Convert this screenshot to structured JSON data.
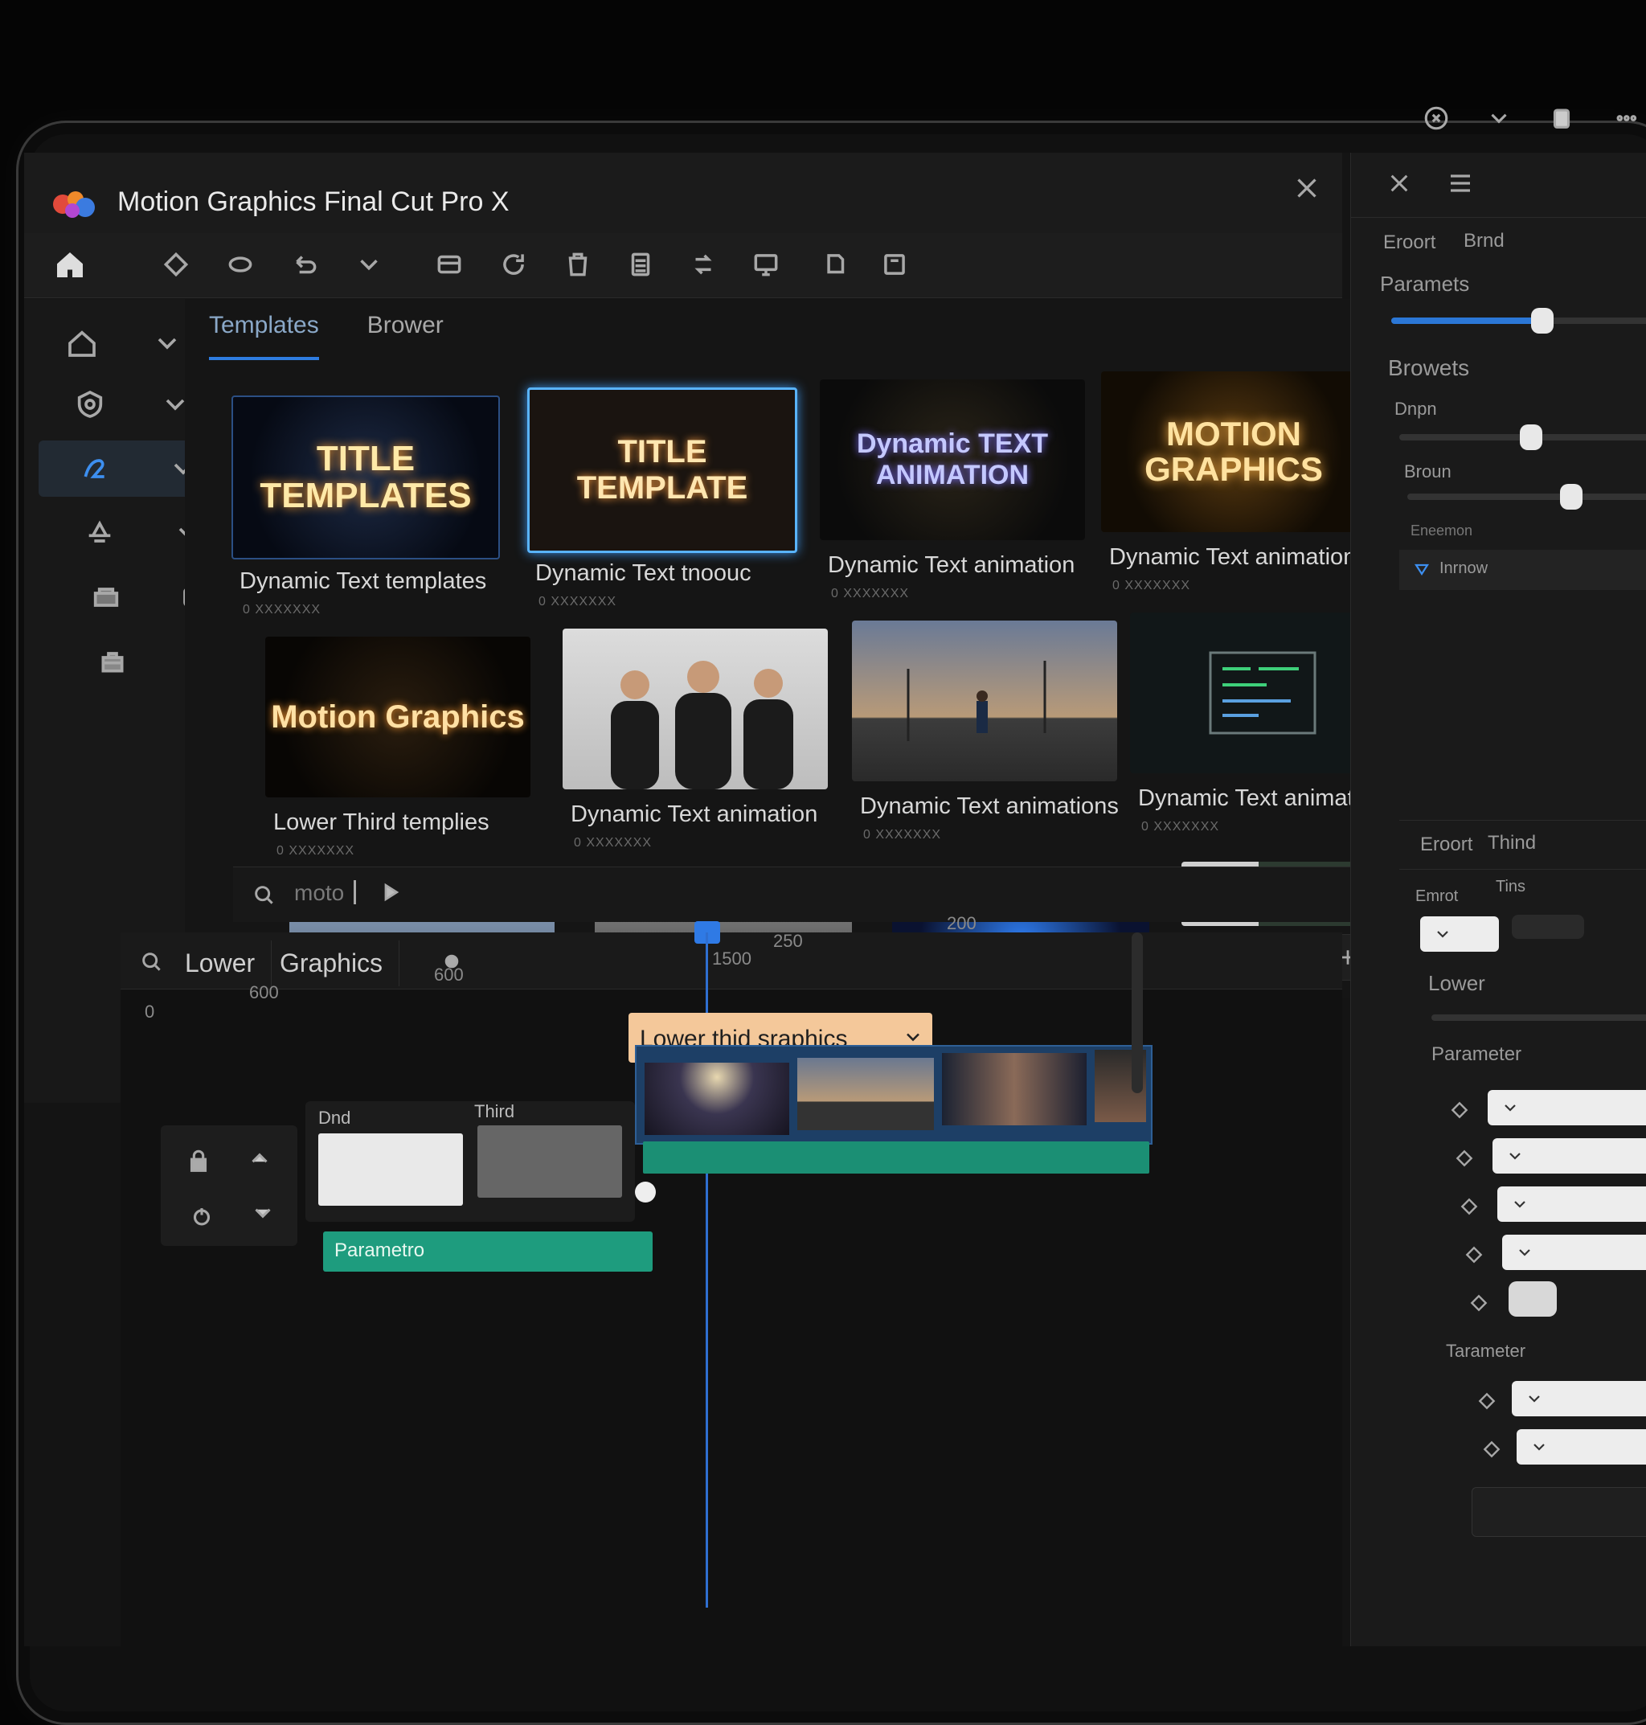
{
  "window": {
    "title": "Motion Graphics  Final Cut Pro X"
  },
  "system_tray": {
    "icons": [
      "close-circle-icon",
      "chevron-down-icon",
      "clipboard-icon",
      "ellipsis-icon"
    ]
  },
  "toolbar": {
    "icons": [
      "home-icon",
      "tag-icon",
      "link-icon",
      "chevron-down-icon",
      "layers-icon",
      "refresh-icon",
      "trash-icon",
      "list-icon",
      "rotate-icon",
      "monitor-icon",
      "copy-icon",
      "frame-icon"
    ]
  },
  "browser": {
    "tabs": [
      "Templates",
      "Brower"
    ],
    "cards": [
      {
        "thumb_text": "TITLE TEMPLATES",
        "label": "Dynamic Text templates",
        "meta": "0 XXXXXXX"
      },
      {
        "thumb_text": "TITLE TEMPLATE",
        "label": "Dynamic Text tnoouc",
        "meta": "0 XXXXXXX"
      },
      {
        "thumb_text": "Dynamic TEXT ANIMATION",
        "label": "Dynamic Text animation",
        "meta": "0 XXXXXXX"
      },
      {
        "thumb_text": "MOTION GRAPHICS",
        "label": "Dynamic Text animation",
        "meta": "0 XXXXXXX"
      },
      {
        "thumb_text": "Motion Graphics",
        "label": "Lower Third templies",
        "meta": "0 XXXXXXX"
      },
      {
        "thumb_text": "",
        "label": "Dynamic Text animation",
        "meta": "0 XXXXXXX"
      },
      {
        "thumb_text": "",
        "label": "Dynamic Text animations",
        "meta": "0 XXXXXXX"
      },
      {
        "thumb_text": "",
        "label": "Dynamic Text animation",
        "meta": "0 XXXXXXX"
      }
    ],
    "search_text": "moto"
  },
  "right_panel": {
    "top_tabs": [
      "Eroort",
      "Brnd"
    ],
    "sections": [
      "Paramets",
      "Browets",
      "Dnpn",
      "Broun",
      "Eneemon",
      "Inrnow"
    ],
    "lower_tabs": [
      "Eroort",
      "Thind"
    ],
    "lower_labels": [
      "Emrot",
      "Tins",
      "Lower",
      "Parameter",
      "Tarameter"
    ],
    "slider_values": [
      0.56,
      0.45,
      0.6,
      0.92
    ]
  },
  "timeline": {
    "tabs": [
      "Lower",
      "Graphics"
    ],
    "ruler": [
      "0",
      "600",
      "600",
      "1500",
      "250",
      "200"
    ],
    "clip_title": "Lower thid sraphics",
    "track_labels": [
      "Dnd",
      "Third"
    ],
    "audio_label": "Parametro"
  },
  "colors": {
    "accent": "#2e7ce0",
    "clip_orange": "#f4c89a",
    "track_green": "#1e9c7e",
    "filmstrip_blue": "#1d3f66"
  }
}
